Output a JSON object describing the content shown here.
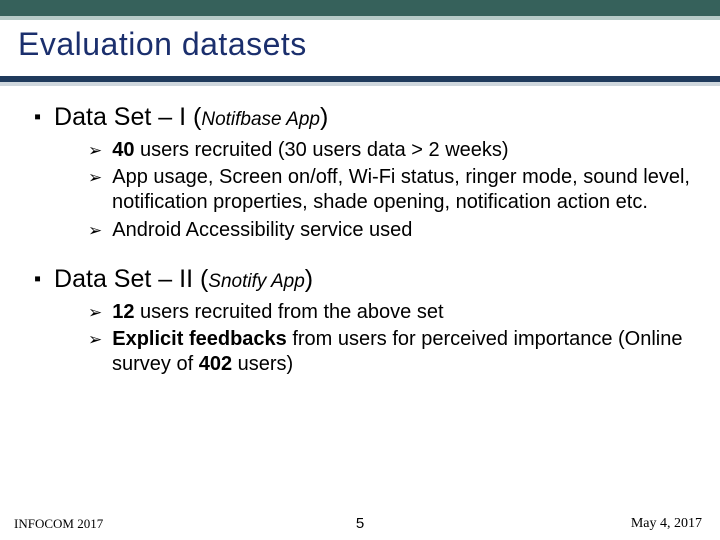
{
  "title": "Evaluation datasets",
  "ds1": {
    "heading_prefix": "Data Set – I (",
    "heading_app": "Notifbase App",
    "heading_suffix": ")",
    "b1_bold": "40",
    "b1_rest": " users recruited (30 users data > 2 weeks)",
    "b2": "App usage, Screen on/off, Wi-Fi status, ringer mode, sound level, notification properties, shade opening, notification action etc.",
    "b3": "Android Accessibility service used"
  },
  "ds2": {
    "heading_prefix": "Data Set – II (",
    "heading_app": "Snotify App",
    "heading_suffix": ")",
    "b1_bold": "12",
    "b1_rest": " users recruited from the above set",
    "b2_bold": "Explicit feedbacks",
    "b2_mid": " from users for perceived importance (Online survey of ",
    "b2_n": "402",
    "b2_end": " users)"
  },
  "footer": {
    "conf": "INFOCOM 2017",
    "page": "5",
    "date": "May 4, 2017"
  }
}
